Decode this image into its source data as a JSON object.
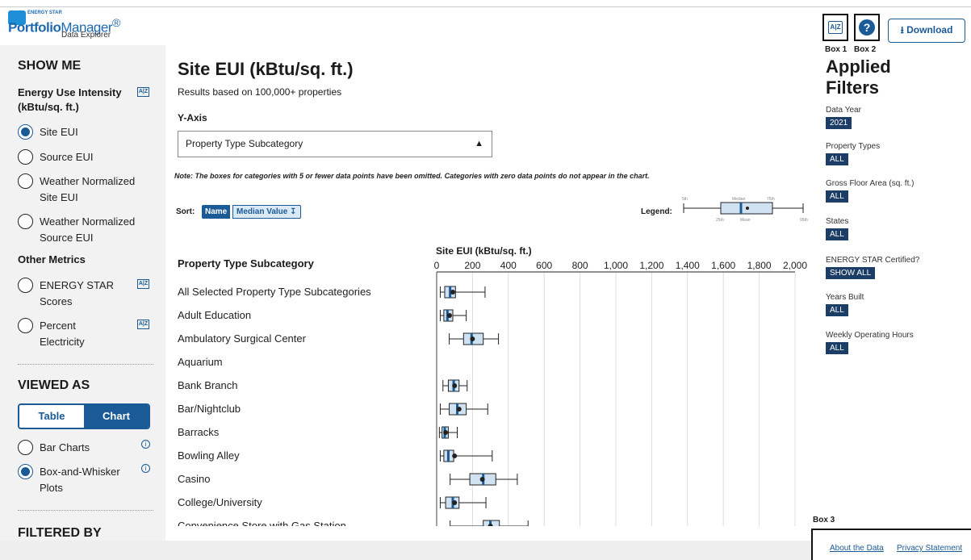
{
  "header": {
    "logo_small": "ENERGY STAR",
    "logo_main_bold": "Portfolio",
    "logo_main_rest": "Manager",
    "logo_sub": "Data Explorer",
    "az_icon_text": "A|Z",
    "help_icon_text": "?",
    "download_label": "Download",
    "box1": "Box 1",
    "box2": "Box 2",
    "box3": "Box 3"
  },
  "sidebar": {
    "show_me": "SHOW ME",
    "eui_heading": "Energy Use Intensity (kBtu/sq. ft.)",
    "eui_options": [
      "Site EUI",
      "Source EUI",
      "Weather Normalized Site EUI",
      "Weather Normalized Source EUI"
    ],
    "other_metrics": "Other Metrics",
    "other_options": [
      "ENERGY STAR Scores",
      "Percent Electricity"
    ],
    "viewed_as": "VIEWED AS",
    "toggle": [
      "Table",
      "Chart"
    ],
    "chart_options": [
      "Bar Charts",
      "Box-and-Whisker Plots"
    ],
    "filtered_by": "FILTERED BY"
  },
  "main": {
    "title": "Site EUI (kBtu/sq. ft.)",
    "subtitle": "Results based on 100,000+ properties",
    "yaxis_label": "Y-Axis",
    "select_value": "Property Type Subcategory",
    "note": "Note: The boxes for categories with 5 or fewer data points have been omitted. Categories with zero data points do not appear in the chart.",
    "sort_label": "Sort:",
    "sort_name": "Name",
    "sort_median": "Median Value",
    "legend_label": "Legend:",
    "legend_marks": [
      "5th",
      "Median",
      "75th",
      "25th",
      "Mean",
      "95th"
    ],
    "column_header": "Property Type Subcategory"
  },
  "chart_data": {
    "type": "box",
    "title": "Site EUI (kBtu/sq. ft.)",
    "xlim": [
      0,
      2000
    ],
    "ticks": [
      0,
      200,
      400,
      600,
      800,
      1000,
      1200,
      1400,
      1600,
      1800,
      2000
    ],
    "tick_labels": [
      "0",
      "200",
      "400",
      "600",
      "800",
      "1,000",
      "1,200",
      "1,400",
      "1,600",
      "1,800",
      "2,000"
    ],
    "categories": [
      {
        "name": "All Selected Property Type Subcategories",
        "p5": 20,
        "p25": 45,
        "median": 75,
        "p75": 105,
        "p95": 270,
        "mean": 90
      },
      {
        "name": "Adult Education",
        "p5": 20,
        "p25": 40,
        "median": 60,
        "p75": 90,
        "p95": 165,
        "mean": 72
      },
      {
        "name": "Ambulatory Surgical Center",
        "p5": 70,
        "p25": 150,
        "median": 195,
        "p75": 260,
        "p95": 345,
        "mean": 200
      },
      {
        "name": "Aquarium"
      },
      {
        "name": "Bank Branch",
        "p5": 35,
        "p25": 65,
        "median": 95,
        "p75": 125,
        "p95": 170,
        "mean": 100
      },
      {
        "name": "Bar/Nightclub",
        "p5": 20,
        "p25": 70,
        "median": 115,
        "p75": 165,
        "p95": 285,
        "mean": 125
      },
      {
        "name": "Barracks",
        "p5": 15,
        "p25": 30,
        "median": 45,
        "p75": 65,
        "p95": 115,
        "mean": 50
      },
      {
        "name": "Bowling Alley",
        "p5": 20,
        "p25": 40,
        "median": 65,
        "p75": 95,
        "p95": 310,
        "mean": 100
      },
      {
        "name": "Casino",
        "p5": 75,
        "p25": 185,
        "median": 260,
        "p75": 330,
        "p95": 450,
        "mean": 255
      },
      {
        "name": "College/University",
        "p5": 20,
        "p25": 50,
        "median": 90,
        "p75": 125,
        "p95": 275,
        "mean": 100
      },
      {
        "name": "Convenience Store with Gas Station",
        "p5": 75,
        "p25": 260,
        "median": 300,
        "p75": 350,
        "p95": 510,
        "mean": 300
      }
    ]
  },
  "right": {
    "title": "Applied Filters",
    "filters": [
      {
        "label": "Data Year",
        "chip": "2021"
      },
      {
        "label": "Property Types",
        "chip": "ALL"
      },
      {
        "label": "Gross Floor Area (sq. ft.)",
        "chip": "ALL"
      },
      {
        "label": "States",
        "chip": "ALL"
      },
      {
        "label": "ENERGY STAR Certified?",
        "chip": "SHOW ALL"
      },
      {
        "label": "Years Built",
        "chip": "ALL"
      },
      {
        "label": "Weekly Operating Hours",
        "chip": "ALL"
      }
    ]
  },
  "footer": {
    "about": "About the Data",
    "privacy": "Privacy Statement"
  },
  "colors": {
    "primary": "#1a5a96",
    "box_fill": "#d0e2f2",
    "chip": "#1b3d66"
  }
}
